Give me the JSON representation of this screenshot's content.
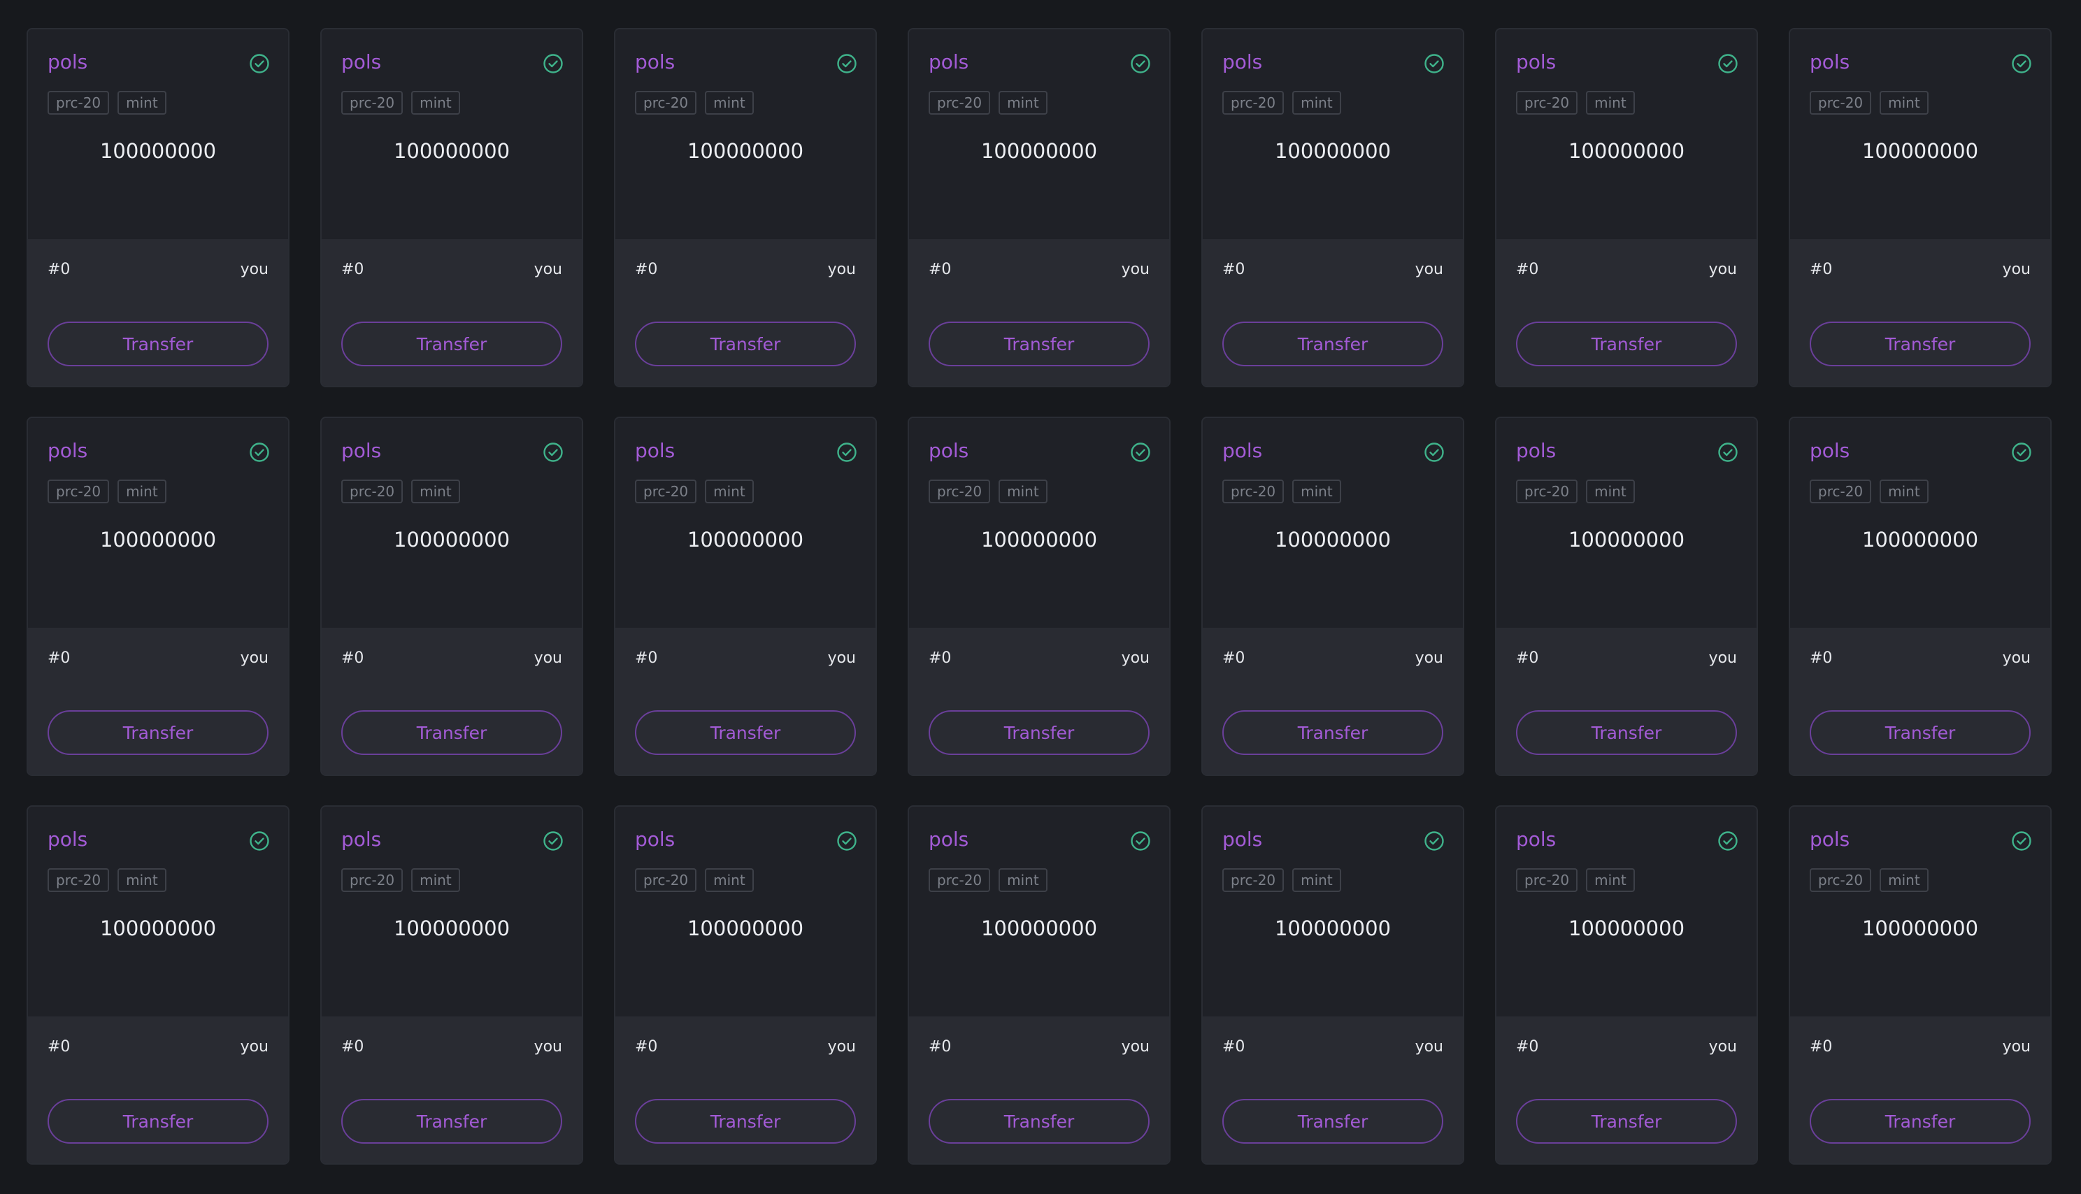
{
  "colors": {
    "background": "#17191d",
    "card_top": "#1f2127",
    "card_bottom": "#292b32",
    "accent_purple": "#a35bd6",
    "check_green": "#3fb38b"
  },
  "cards": [
    {
      "ticker": "pols",
      "tags": [
        "prc-20",
        "mint"
      ],
      "amount": "100000000",
      "number": "#0",
      "owner": "you",
      "action": "Transfer",
      "status_icon": "check-circle-icon"
    },
    {
      "ticker": "pols",
      "tags": [
        "prc-20",
        "mint"
      ],
      "amount": "100000000",
      "number": "#0",
      "owner": "you",
      "action": "Transfer",
      "status_icon": "check-circle-icon"
    },
    {
      "ticker": "pols",
      "tags": [
        "prc-20",
        "mint"
      ],
      "amount": "100000000",
      "number": "#0",
      "owner": "you",
      "action": "Transfer",
      "status_icon": "check-circle-icon"
    },
    {
      "ticker": "pols",
      "tags": [
        "prc-20",
        "mint"
      ],
      "amount": "100000000",
      "number": "#0",
      "owner": "you",
      "action": "Transfer",
      "status_icon": "check-circle-icon"
    },
    {
      "ticker": "pols",
      "tags": [
        "prc-20",
        "mint"
      ],
      "amount": "100000000",
      "number": "#0",
      "owner": "you",
      "action": "Transfer",
      "status_icon": "check-circle-icon"
    },
    {
      "ticker": "pols",
      "tags": [
        "prc-20",
        "mint"
      ],
      "amount": "100000000",
      "number": "#0",
      "owner": "you",
      "action": "Transfer",
      "status_icon": "check-circle-icon"
    },
    {
      "ticker": "pols",
      "tags": [
        "prc-20",
        "mint"
      ],
      "amount": "100000000",
      "number": "#0",
      "owner": "you",
      "action": "Transfer",
      "status_icon": "check-circle-icon"
    },
    {
      "ticker": "pols",
      "tags": [
        "prc-20",
        "mint"
      ],
      "amount": "100000000",
      "number": "#0",
      "owner": "you",
      "action": "Transfer",
      "status_icon": "check-circle-icon"
    },
    {
      "ticker": "pols",
      "tags": [
        "prc-20",
        "mint"
      ],
      "amount": "100000000",
      "number": "#0",
      "owner": "you",
      "action": "Transfer",
      "status_icon": "check-circle-icon"
    },
    {
      "ticker": "pols",
      "tags": [
        "prc-20",
        "mint"
      ],
      "amount": "100000000",
      "number": "#0",
      "owner": "you",
      "action": "Transfer",
      "status_icon": "check-circle-icon"
    },
    {
      "ticker": "pols",
      "tags": [
        "prc-20",
        "mint"
      ],
      "amount": "100000000",
      "number": "#0",
      "owner": "you",
      "action": "Transfer",
      "status_icon": "check-circle-icon"
    },
    {
      "ticker": "pols",
      "tags": [
        "prc-20",
        "mint"
      ],
      "amount": "100000000",
      "number": "#0",
      "owner": "you",
      "action": "Transfer",
      "status_icon": "check-circle-icon"
    },
    {
      "ticker": "pols",
      "tags": [
        "prc-20",
        "mint"
      ],
      "amount": "100000000",
      "number": "#0",
      "owner": "you",
      "action": "Transfer",
      "status_icon": "check-circle-icon"
    },
    {
      "ticker": "pols",
      "tags": [
        "prc-20",
        "mint"
      ],
      "amount": "100000000",
      "number": "#0",
      "owner": "you",
      "action": "Transfer",
      "status_icon": "check-circle-icon"
    },
    {
      "ticker": "pols",
      "tags": [
        "prc-20",
        "mint"
      ],
      "amount": "100000000",
      "number": "#0",
      "owner": "you",
      "action": "Transfer",
      "status_icon": "check-circle-icon"
    },
    {
      "ticker": "pols",
      "tags": [
        "prc-20",
        "mint"
      ],
      "amount": "100000000",
      "number": "#0",
      "owner": "you",
      "action": "Transfer",
      "status_icon": "check-circle-icon"
    },
    {
      "ticker": "pols",
      "tags": [
        "prc-20",
        "mint"
      ],
      "amount": "100000000",
      "number": "#0",
      "owner": "you",
      "action": "Transfer",
      "status_icon": "check-circle-icon"
    },
    {
      "ticker": "pols",
      "tags": [
        "prc-20",
        "mint"
      ],
      "amount": "100000000",
      "number": "#0",
      "owner": "you",
      "action": "Transfer",
      "status_icon": "check-circle-icon"
    },
    {
      "ticker": "pols",
      "tags": [
        "prc-20",
        "mint"
      ],
      "amount": "100000000",
      "number": "#0",
      "owner": "you",
      "action": "Transfer",
      "status_icon": "check-circle-icon"
    },
    {
      "ticker": "pols",
      "tags": [
        "prc-20",
        "mint"
      ],
      "amount": "100000000",
      "number": "#0",
      "owner": "you",
      "action": "Transfer",
      "status_icon": "check-circle-icon"
    },
    {
      "ticker": "pols",
      "tags": [
        "prc-20",
        "mint"
      ],
      "amount": "100000000",
      "number": "#0",
      "owner": "you",
      "action": "Transfer",
      "status_icon": "check-circle-icon"
    }
  ]
}
